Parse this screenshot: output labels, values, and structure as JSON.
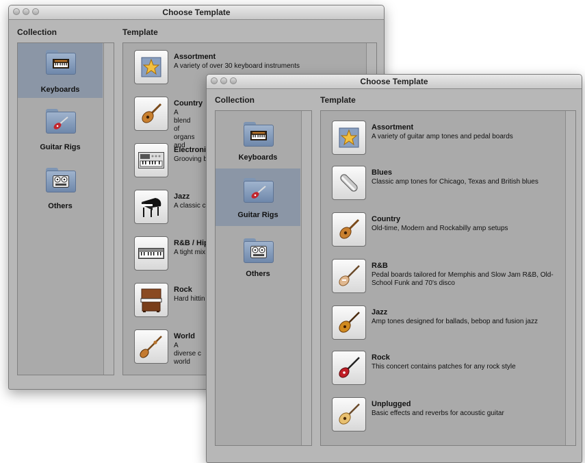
{
  "back_window": {
    "title": "Choose Template",
    "collection_header": "Collection",
    "template_header": "Template",
    "collections": [
      {
        "label": "Keyboards",
        "icon": "keyboard-icon",
        "selected": true
      },
      {
        "label": "Guitar Rigs",
        "icon": "guitar-icon",
        "selected": false
      },
      {
        "label": "Others",
        "icon": "tape-deck-icon",
        "selected": false
      }
    ],
    "templates": [
      {
        "name": "Assortment",
        "desc": "A variety of over 30 keyboard instruments",
        "icon": "star-icon"
      },
      {
        "name": "Country",
        "desc": "A blend of organs and",
        "icon": "mandolin-icon"
      },
      {
        "name": "Electronic",
        "desc": "Grooving b",
        "icon": "synthesizer-icon"
      },
      {
        "name": "Jazz",
        "desc": "A classic c",
        "icon": "grand-piano-icon"
      },
      {
        "name": "R&B / Hip",
        "desc": "A tight mix",
        "icon": "keyboard-icon"
      },
      {
        "name": "Rock",
        "desc": "Hard hittin",
        "icon": "organ-icon"
      },
      {
        "name": "World",
        "desc": "A diverse c world",
        "icon": "sitar-icon"
      }
    ]
  },
  "front_window": {
    "title": "Choose Template",
    "collection_header": "Collection",
    "template_header": "Template",
    "collections": [
      {
        "label": "Keyboards",
        "icon": "keyboard-icon",
        "selected": false
      },
      {
        "label": "Guitar Rigs",
        "icon": "guitar-icon",
        "selected": true
      },
      {
        "label": "Others",
        "icon": "tape-deck-icon",
        "selected": false
      }
    ],
    "templates": [
      {
        "name": "Assortment",
        "desc": "A variety of guitar amp tones and pedal boards",
        "icon": "star-icon"
      },
      {
        "name": "Blues",
        "desc": "Classic amp tones for Chicago, Texas and British blues",
        "icon": "slide-icon"
      },
      {
        "name": "Country",
        "desc": "Old-time, Modern and Rockabilly amp setups",
        "icon": "mandolin-icon"
      },
      {
        "name": "R&B",
        "desc": "Pedal boards tailored for Memphis and Slow Jam R&B, Old-School Funk and 70's disco",
        "icon": "bass-guitar-icon"
      },
      {
        "name": "Jazz",
        "desc": "Amp tones designed for ballads, bebop and fusion jazz",
        "icon": "jazz-guitar-icon"
      },
      {
        "name": "Rock",
        "desc": "This concert contains patches for any rock style",
        "icon": "electric-guitar-icon"
      },
      {
        "name": "Unplugged",
        "desc": "Basic effects and reverbs for acoustic guitar",
        "icon": "acoustic-guitar-icon"
      }
    ]
  }
}
